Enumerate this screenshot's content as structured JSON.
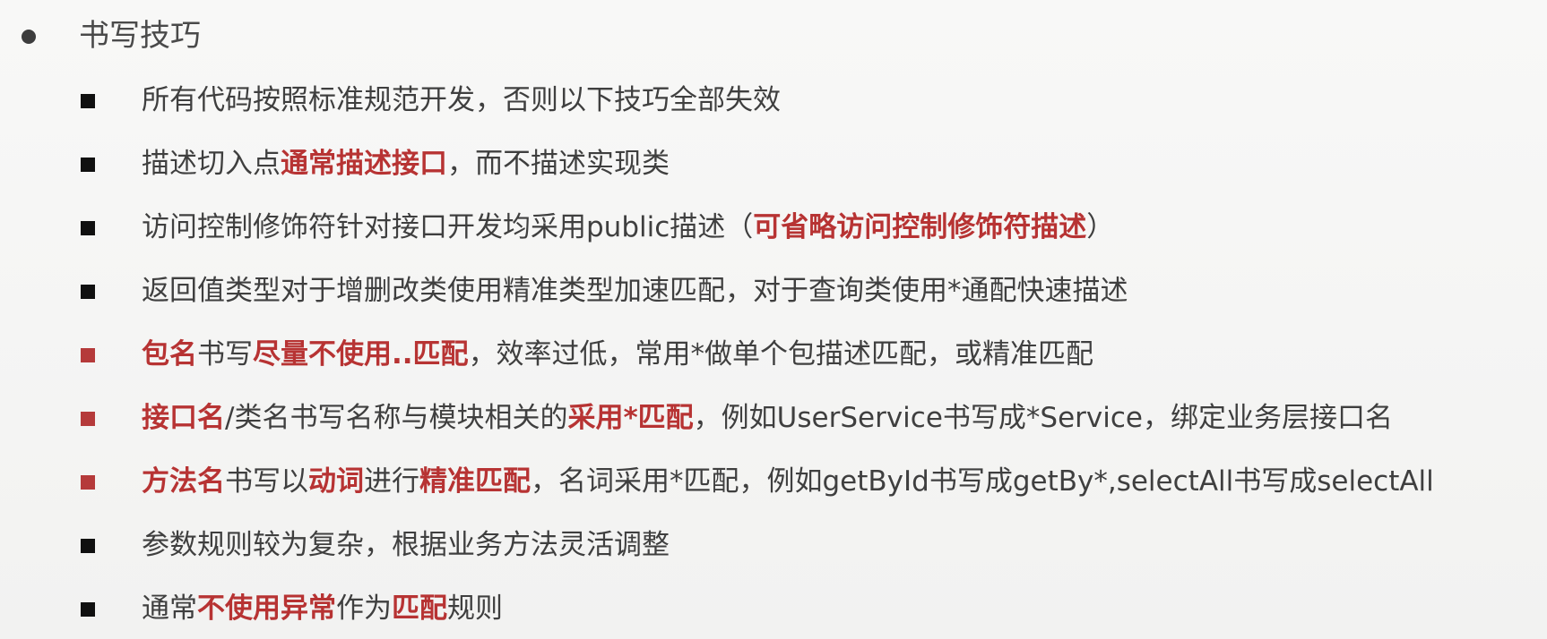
{
  "heading": "书写技巧",
  "items": [
    {
      "red_marker": false,
      "parts": [
        {
          "t": "所有代码按照标准规范开发，否则以下技巧全部失效",
          "hl": false
        }
      ]
    },
    {
      "red_marker": false,
      "parts": [
        {
          "t": "描述切入点",
          "hl": false
        },
        {
          "t": "通常描述接口",
          "hl": true
        },
        {
          "t": "，而不描述实现类",
          "hl": false
        }
      ]
    },
    {
      "red_marker": false,
      "parts": [
        {
          "t": "访问控制修饰符针对接口开发均采用public描述（",
          "hl": false
        },
        {
          "t": "可省略访问控制修饰符描述",
          "hl": true
        },
        {
          "t": "）",
          "hl": false
        }
      ]
    },
    {
      "red_marker": false,
      "parts": [
        {
          "t": "返回值类型对于增删改类使用精准类型加速匹配，对于查询类使用*通配快速描述",
          "hl": false
        }
      ]
    },
    {
      "red_marker": true,
      "parts": [
        {
          "t": "包名",
          "hl": true
        },
        {
          "t": "书写",
          "hl": false
        },
        {
          "t": "尽量不使用..匹配",
          "hl": true
        },
        {
          "t": "，效率过低，常用*做单个包描述匹配，或精准匹配",
          "hl": false
        }
      ]
    },
    {
      "red_marker": true,
      "parts": [
        {
          "t": "接口名",
          "hl": true
        },
        {
          "t": "/类名书写名称与模块相关的",
          "hl": false
        },
        {
          "t": "采用*匹配",
          "hl": true
        },
        {
          "t": "，例如UserService书写成*Service，绑定业务层接口名",
          "hl": false
        }
      ]
    },
    {
      "red_marker": true,
      "parts": [
        {
          "t": "方法名",
          "hl": true
        },
        {
          "t": "书写以",
          "hl": false
        },
        {
          "t": "动词",
          "hl": true
        },
        {
          "t": "进行",
          "hl": false
        },
        {
          "t": "精准匹配",
          "hl": true
        },
        {
          "t": "，名词采用*匹配，例如getById书写成getBy*,selectAll书写成selectAll",
          "hl": false
        }
      ]
    },
    {
      "red_marker": false,
      "parts": [
        {
          "t": "参数规则较为复杂，根据业务方法灵活调整",
          "hl": false
        }
      ]
    },
    {
      "red_marker": false,
      "parts": [
        {
          "t": "通常",
          "hl": false
        },
        {
          "t": "不使用异常",
          "hl": true
        },
        {
          "t": "作为",
          "hl": false
        },
        {
          "t": "匹配",
          "hl": true
        },
        {
          "t": "规则",
          "hl": false
        }
      ]
    }
  ],
  "colors": {
    "highlight": "#b73333",
    "text": "#3f3f3f",
    "marker_dark": "#101010",
    "marker_red": "#b53a3a"
  }
}
